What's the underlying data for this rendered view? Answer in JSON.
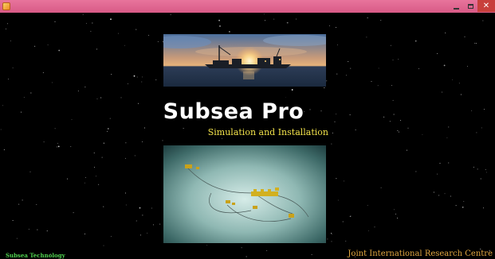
{
  "window": {
    "controls": {
      "minimize_icon": "minimize-icon",
      "maximize_icon": "maximize-icon",
      "close_icon": "close-icon",
      "close_glyph": "✕"
    },
    "title_bar_color": "#e06a93",
    "close_color": "#c8403c"
  },
  "splash": {
    "title": "Subsea Pro",
    "subtitle": "Simulation and Installation",
    "top_image": "offshore-sunset-vessel-image",
    "bottom_image": "subsea-field-layout-image"
  },
  "footer": {
    "left": "Subsea Technology",
    "right": "Joint International Research Centre"
  },
  "colors": {
    "background": "#000000",
    "subtitle": "#f2e24a",
    "footer_left": "#4fd04f",
    "footer_right": "#e0a640"
  }
}
